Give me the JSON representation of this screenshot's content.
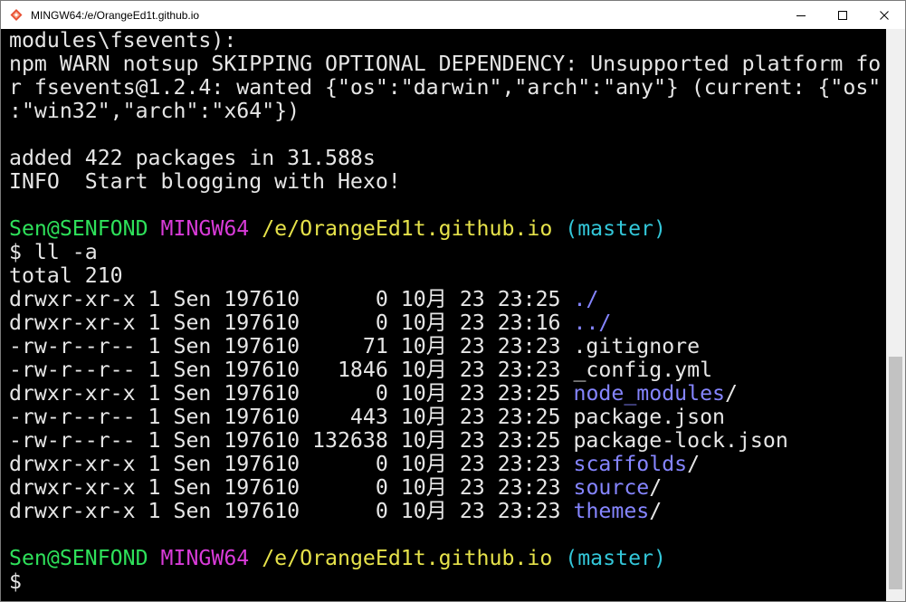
{
  "window": {
    "title": "MINGW64:/e/OrangeEd1t.github.io",
    "controls": {
      "minimize": "minimize",
      "maximize": "maximize",
      "close": "close"
    }
  },
  "terminal": {
    "colors": {
      "background": "#000000",
      "text": "#e6e6e6",
      "user": "#2ee15a",
      "shell": "#d93bd9",
      "path": "#e6e24a",
      "branch": "#33c7d9",
      "directory": "#8585ff"
    },
    "lines": [
      {
        "segments": [
          {
            "text": "modules\\fsevents):",
            "color": "white"
          }
        ]
      },
      {
        "segments": [
          {
            "text": "npm WARN notsup SKIPPING OPTIONAL DEPENDENCY: Unsupported platform fo",
            "color": "white"
          }
        ]
      },
      {
        "segments": [
          {
            "text": "r fsevents@1.2.4: wanted {\"os\":\"darwin\",\"arch\":\"any\"} (current: {\"os\"",
            "color": "white"
          }
        ]
      },
      {
        "segments": [
          {
            "text": ":\"win32\",\"arch\":\"x64\"})",
            "color": "white"
          }
        ]
      },
      {
        "segments": [
          {
            "text": "",
            "color": "white"
          }
        ]
      },
      {
        "segments": [
          {
            "text": "added 422 packages in 31.588s",
            "color": "white"
          }
        ]
      },
      {
        "segments": [
          {
            "text": "INFO  Start blogging with Hexo!",
            "color": "white"
          }
        ]
      },
      {
        "segments": [
          {
            "text": "",
            "color": "white"
          }
        ]
      },
      {
        "segments": [
          {
            "text": "Sen@SENFOND ",
            "color": "green"
          },
          {
            "text": "MINGW64 ",
            "color": "magenta"
          },
          {
            "text": "/e/OrangeEd1t.github.io ",
            "color": "yellow"
          },
          {
            "text": "(master)",
            "color": "cyan"
          }
        ]
      },
      {
        "segments": [
          {
            "text": "$ ll -a",
            "color": "white"
          }
        ]
      },
      {
        "segments": [
          {
            "text": "total 210",
            "color": "white"
          }
        ]
      },
      {
        "segments": [
          {
            "text": "drwxr-xr-x 1 Sen 197610      0 10月 23 23:25 ",
            "color": "white"
          },
          {
            "text": "./",
            "color": "blue"
          }
        ]
      },
      {
        "segments": [
          {
            "text": "drwxr-xr-x 1 Sen 197610      0 10月 23 23:16 ",
            "color": "white"
          },
          {
            "text": "../",
            "color": "blue"
          }
        ]
      },
      {
        "segments": [
          {
            "text": "-rw-r--r-- 1 Sen 197610     71 10月 23 23:23 .gitignore",
            "color": "white"
          }
        ]
      },
      {
        "segments": [
          {
            "text": "-rw-r--r-- 1 Sen 197610   1846 10月 23 23:23 _config.yml",
            "color": "white"
          }
        ]
      },
      {
        "segments": [
          {
            "text": "drwxr-xr-x 1 Sen 197610      0 10月 23 23:25 ",
            "color": "white"
          },
          {
            "text": "node_modules",
            "color": "blue"
          },
          {
            "text": "/",
            "color": "white"
          }
        ]
      },
      {
        "segments": [
          {
            "text": "-rw-r--r-- 1 Sen 197610    443 10月 23 23:25 package.json",
            "color": "white"
          }
        ]
      },
      {
        "segments": [
          {
            "text": "-rw-r--r-- 1 Sen 197610 132638 10月 23 23:25 package-lock.json",
            "color": "white"
          }
        ]
      },
      {
        "segments": [
          {
            "text": "drwxr-xr-x 1 Sen 197610      0 10月 23 23:23 ",
            "color": "white"
          },
          {
            "text": "scaffolds",
            "color": "blue"
          },
          {
            "text": "/",
            "color": "white"
          }
        ]
      },
      {
        "segments": [
          {
            "text": "drwxr-xr-x 1 Sen 197610      0 10月 23 23:23 ",
            "color": "white"
          },
          {
            "text": "source",
            "color": "blue"
          },
          {
            "text": "/",
            "color": "white"
          }
        ]
      },
      {
        "segments": [
          {
            "text": "drwxr-xr-x 1 Sen 197610      0 10月 23 23:23 ",
            "color": "white"
          },
          {
            "text": "themes",
            "color": "blue"
          },
          {
            "text": "/",
            "color": "white"
          }
        ]
      },
      {
        "segments": [
          {
            "text": "",
            "color": "white"
          }
        ]
      },
      {
        "segments": [
          {
            "text": "Sen@SENFOND ",
            "color": "green"
          },
          {
            "text": "MINGW64 ",
            "color": "magenta"
          },
          {
            "text": "/e/OrangeEd1t.github.io ",
            "color": "yellow"
          },
          {
            "text": "(master)",
            "color": "cyan"
          }
        ]
      },
      {
        "segments": [
          {
            "text": "$",
            "color": "white"
          }
        ]
      }
    ]
  },
  "icons": {
    "app": "mingw-icon",
    "minimize": "minimize-icon",
    "maximize": "maximize-icon",
    "close": "close-icon"
  }
}
